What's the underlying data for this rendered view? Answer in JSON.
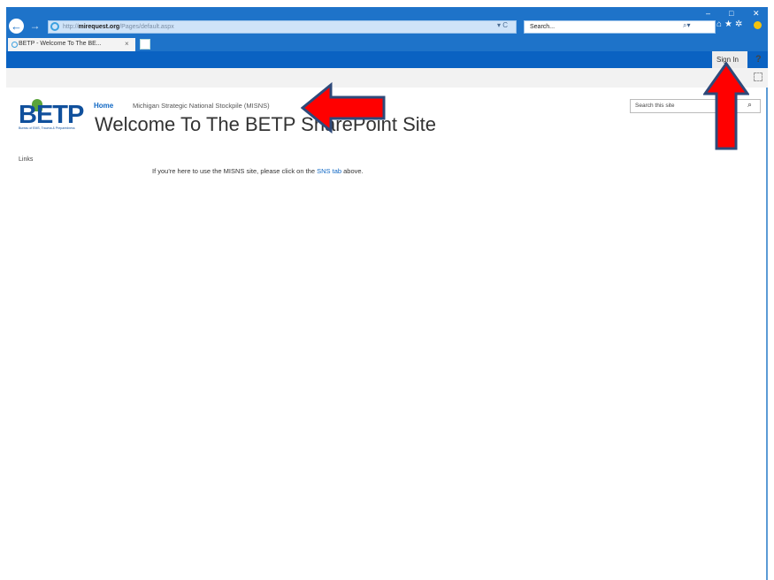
{
  "browser": {
    "address_prefix": "http://",
    "address_host": "mirequest.org",
    "address_path": "/Pages/default.aspx",
    "address_tools": "▾ C",
    "search_placeholder": "Search...",
    "tab_title": "BETP - Welcome To The BE...",
    "tab_close": "×",
    "win_minimize": "–",
    "win_maximize": "□",
    "win_close": "✕"
  },
  "suite": {
    "sign_in": "Sign In",
    "help": "?"
  },
  "site": {
    "logo": "BETP",
    "logo_tagline": "Bureau of EMS, Trauma & Preparedness",
    "nav": [
      {
        "label": "Home"
      },
      {
        "label": "Michigan Strategic National Stockpile (MISNS)"
      }
    ],
    "title": "Welcome To The BETP SharePoint Site",
    "search_placeholder": "Search this site",
    "left_nav_links": "Links",
    "message_before": "If you're here to use the MISNS site, please click on the ",
    "message_link": "SNS tab",
    "message_after": " above."
  },
  "colors": {
    "browser_blue": "#1e73c9",
    "suite_bar": "#0a62c2",
    "link_blue": "#0f67c4",
    "annotation_red": "#ff0000",
    "annotation_outline": "#2e4a7a"
  },
  "icons": [
    "back-icon",
    "forward-icon",
    "ie-icon",
    "search-icon",
    "home-icon",
    "favorites-star-icon",
    "settings-gear-icon",
    "smiley-icon",
    "help-icon",
    "focus-icon"
  ]
}
